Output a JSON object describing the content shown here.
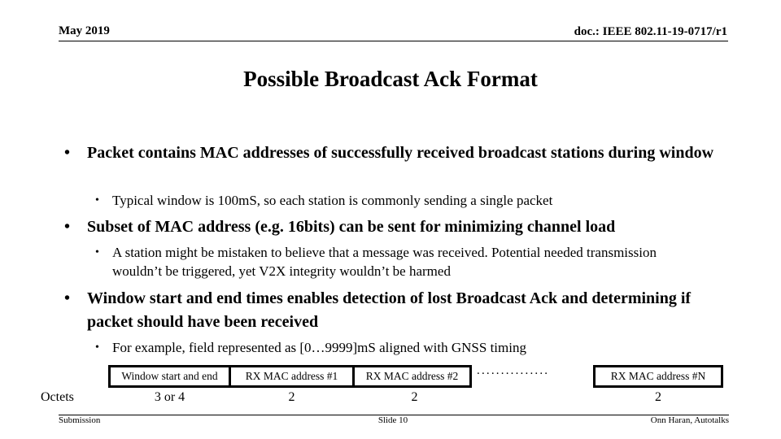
{
  "header": {
    "date": "May 2019",
    "doc_id": "doc.: IEEE 802.11-19-0717/r1"
  },
  "title": "Possible Broadcast Ack Format",
  "bullets": [
    {
      "level": 1,
      "text": "Packet contains MAC addresses of successfully received broadcast stations during window",
      "children": [
        {
          "level": 2,
          "text": "Typical window is 100mS, so each station is commonly sending a single packet"
        }
      ]
    },
    {
      "level": 1,
      "text": "Subset of MAC address (e.g. 16bits) can be sent for minimizing channel load",
      "children": [
        {
          "level": 2,
          "text": "A station might be mistaken to believe that a message was received. Potential needed transmission wouldn’t be triggered, yet V2X integrity wouldn’t be harmed"
        }
      ]
    },
    {
      "level": 1,
      "text": "Window start and end times enables detection of lost Broadcast Ack and determining if packet should have been received",
      "children": [
        {
          "level": 2,
          "text": "For example, field represented as [0…9999]mS aligned with GNSS timing"
        }
      ]
    }
  ],
  "bullet_glyph": "•",
  "frame_format": {
    "fields": [
      {
        "label": "Window start and end",
        "octets": "3 or 4"
      },
      {
        "label": "RX MAC address #1",
        "octets": "2"
      },
      {
        "label": "RX MAC address #2",
        "octets": "2"
      },
      {
        "label": "RX MAC address #N",
        "octets": "2"
      }
    ],
    "ellipsis": "...............",
    "octets_label": "Octets"
  },
  "footer": {
    "left": "Submission",
    "center": "Slide 10",
    "right": "Onn Haran, Autotalks"
  }
}
